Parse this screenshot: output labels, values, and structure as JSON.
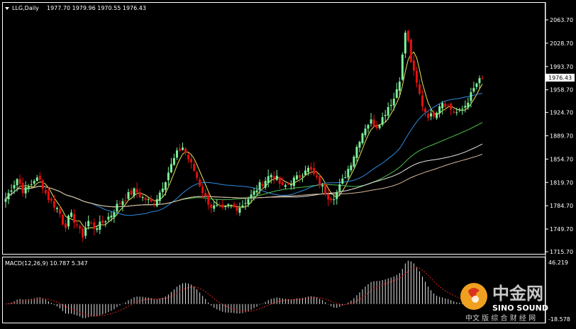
{
  "header": {
    "symbol_label": "LLG,Daily",
    "ohlc": "1977.70 1979.96 1970.55 1976.43"
  },
  "indicator": {
    "label": "MACD(12,26,9) 10.787 5.347",
    "scale_top": "46.219",
    "scale_bottom": "-18.578"
  },
  "price_axis": {
    "current_price": "1976.43",
    "ticks": [
      "2063.70",
      "2028.70",
      "1993.70",
      "1958.70",
      "1924.70",
      "1889.70",
      "1854.70",
      "1819.70",
      "1784.70",
      "1749.70",
      "1715.70"
    ]
  },
  "watermark": {
    "logo_text": "中金网",
    "brand": "SINO SOUND",
    "tagline": "中文 版 综 合 财 经 网"
  },
  "colors": {
    "background": "#000000",
    "bull_candle": "#7cf09a",
    "bear_candle": "#e01010",
    "ma_yellow": "#e6e65a",
    "ma_blue": "#2e8be0",
    "ma_green": "#4ec04e",
    "ma_white": "#e8e8e8",
    "ma_tan": "#d8b89a",
    "macd_hist": "#e0e0e0",
    "macd_signal": "#e02020",
    "axis_text": "#ffffff",
    "grid_border": "#ffffff"
  },
  "chart_data": {
    "type": "candlestick",
    "ylim": [
      1715.7,
      2063.7
    ],
    "close_path": [
      1795,
      1812,
      1826,
      1806,
      1813,
      1826,
      1821,
      1799,
      1788,
      1778,
      1752,
      1772,
      1758,
      1738,
      1762,
      1752,
      1756,
      1764,
      1772,
      1786,
      1794,
      1802,
      1808,
      1798,
      1793,
      1788,
      1801,
      1821,
      1843,
      1862,
      1874,
      1856,
      1838,
      1816,
      1796,
      1783,
      1782,
      1777,
      1786,
      1781,
      1784,
      1794,
      1802,
      1814,
      1822,
      1832,
      1826,
      1812,
      1817,
      1824,
      1829,
      1842,
      1836,
      1822,
      1810,
      1796,
      1800,
      1818,
      1836,
      1856,
      1882,
      1902,
      1912,
      1904,
      1916,
      1934,
      1946,
      1978,
      2052,
      1995,
      1962,
      1930,
      1918,
      1924,
      1942,
      1936,
      1926,
      1924,
      1934,
      1950,
      1968,
      1976
    ]
  }
}
